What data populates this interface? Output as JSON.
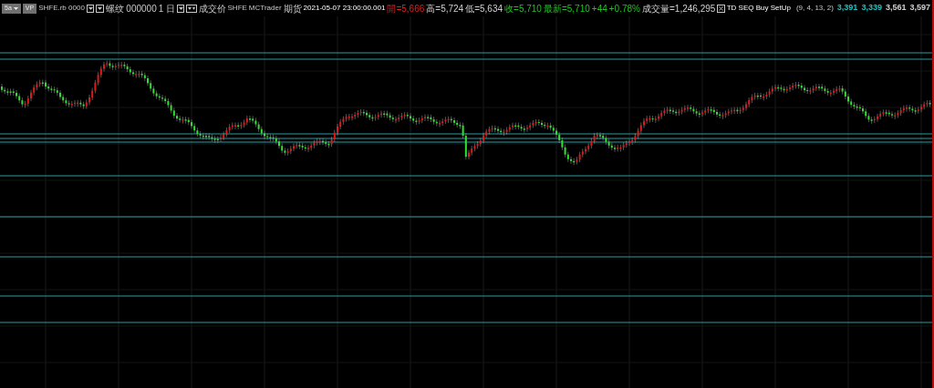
{
  "toolbar": {
    "buttons": [
      {
        "label": "5a",
        "kind": "dropdown"
      },
      {
        "label": "VP",
        "kind": "plain"
      }
    ],
    "symbol": "SHFE.rb 0000",
    "contract": "螺纹 000000",
    "interval": "1 日",
    "price_type": "成交价",
    "exchange": "SHFE",
    "source": "MCTrader",
    "market": "期货",
    "timestamp": "2021-05-07 23:00:00.001",
    "quotes": [
      {
        "text": "開=5,666",
        "color": "#e02020"
      },
      {
        "text": "高=5,724",
        "color": "#d0d0d0"
      },
      {
        "text": "低=5,634",
        "color": "#d0d0d0"
      },
      {
        "text": "收=5,710",
        "color": "#20c020"
      },
      {
        "text": "最新=5,710",
        "color": "#20c020"
      },
      {
        "text": "+44",
        "color": "#20c020"
      },
      {
        "text": "+0.78%",
        "color": "#20c020"
      },
      {
        "text": "成交量=1,246,295",
        "color": "#d0d0d0"
      }
    ]
  },
  "indicator": {
    "name": "TD SEQ Buy SetUp",
    "params": "(9, 4, 13, 2)",
    "values": [
      {
        "text": "3,391",
        "color": "#20c0c0"
      },
      {
        "text": "3,339",
        "color": "#20c0c0"
      },
      {
        "text": "3,561",
        "color": "#d0d0d0"
      },
      {
        "text": "3,597",
        "color": "#d0d0d0"
      }
    ]
  }
}
